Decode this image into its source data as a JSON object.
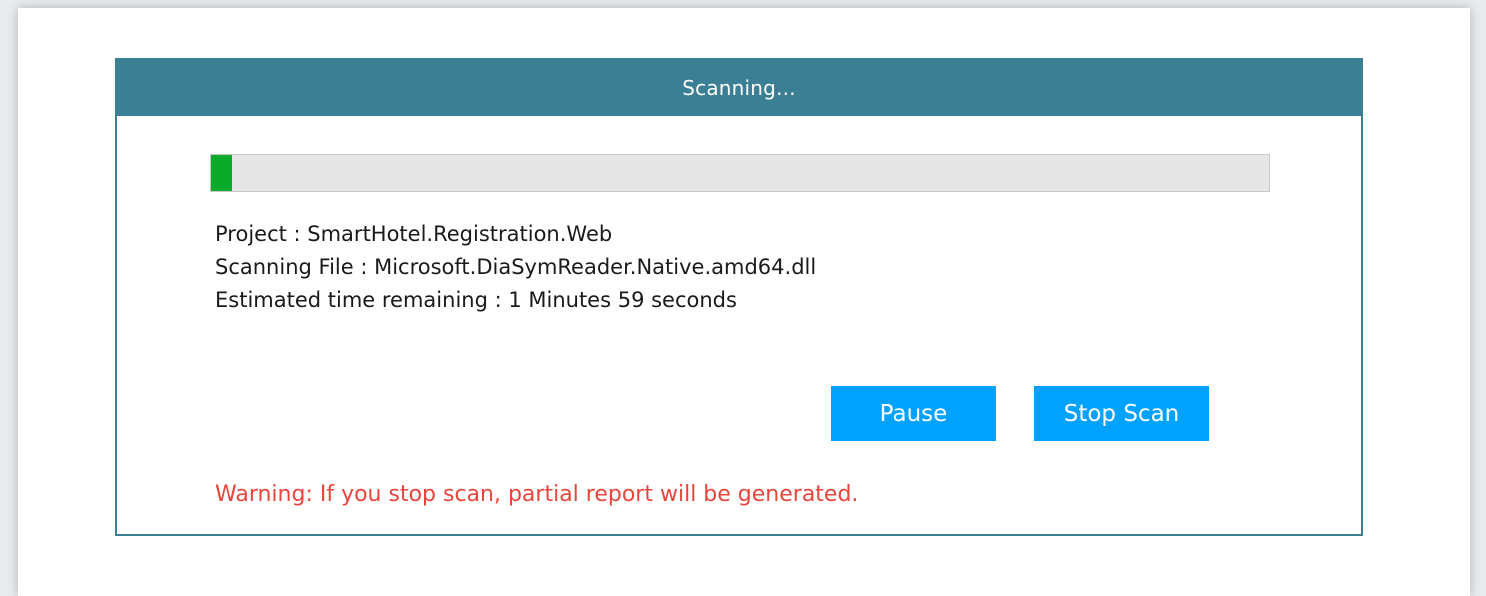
{
  "dialog": {
    "title": "Scanning...",
    "progress_percent": 2,
    "project_line": "Project : SmartHotel.Registration.Web",
    "file_line": "Scanning File : Microsoft.DiaSymReader.Native.amd64.dll",
    "time_line": "Estimated time remaining : 1 Minutes 59 seconds",
    "pause_label": "Pause",
    "stop_label": "Stop Scan",
    "warning": "Warning: If you stop scan, partial report will be generated."
  },
  "colors": {
    "header": "#3b7f95",
    "progress_fill": "#0aaa2b",
    "button": "#00a2ff",
    "warning": "#e8453c"
  }
}
